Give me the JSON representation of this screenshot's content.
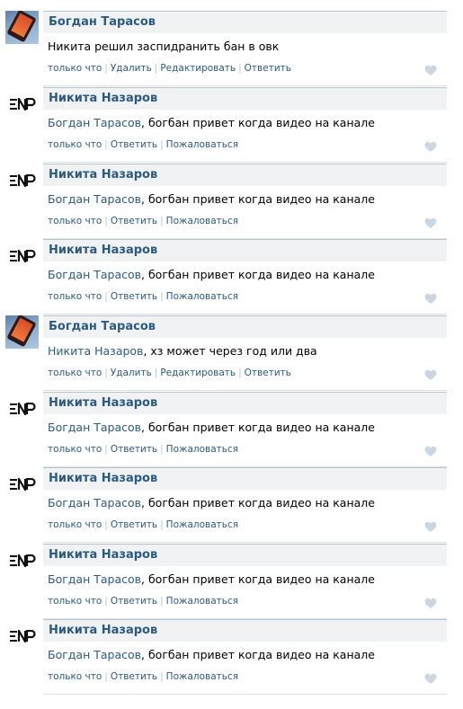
{
  "comments": [
    {
      "author": "Богдан Тарасов",
      "avatar": "photo",
      "mention": "",
      "text": "Никита решил заспидранить бан в овк",
      "actions": [
        "только что",
        "Удалить",
        "Редактировать",
        "Ответить"
      ]
    },
    {
      "author": "Никита Назаров",
      "avatar": "logo",
      "mention": "Богдан Тарасов",
      "text": ", богбан привет когда видео на канале",
      "actions": [
        "только что",
        "Ответить",
        "Пожаловаться"
      ]
    },
    {
      "author": "Никита Назаров",
      "avatar": "logo",
      "mention": "Богдан Тарасов",
      "text": ", богбан привет когда видео на канале",
      "actions": [
        "только что",
        "Ответить",
        "Пожаловаться"
      ]
    },
    {
      "author": "Никита Назаров",
      "avatar": "logo",
      "mention": "Богдан Тарасов",
      "text": ", богбан привет когда видео на канале",
      "actions": [
        "только что",
        "Ответить",
        "Пожаловаться"
      ]
    },
    {
      "author": "Богдан Тарасов",
      "avatar": "photo",
      "mention": "Никита Назаров",
      "text": ", хз может через год или два",
      "actions": [
        "только что",
        "Удалить",
        "Редактировать",
        "Ответить"
      ]
    },
    {
      "author": "Никита Назаров",
      "avatar": "logo",
      "mention": "Богдан Тарасов",
      "text": ", богбан привет когда видео на канале",
      "actions": [
        "только что",
        "Ответить",
        "Пожаловаться"
      ]
    },
    {
      "author": "Никита Назаров",
      "avatar": "logo",
      "mention": "Богдан Тарасов",
      "text": ", богбан привет когда видео на канале",
      "actions": [
        "только что",
        "Ответить",
        "Пожаловаться"
      ]
    },
    {
      "author": "Никита Назаров",
      "avatar": "logo",
      "mention": "Богдан Тарасов",
      "text": ", богбан привет когда видео на канале",
      "actions": [
        "только что",
        "Ответить",
        "Пожаловаться"
      ]
    },
    {
      "author": "Никита Назаров",
      "avatar": "logo",
      "mention": "Богдан Тарасов",
      "text": ", богбан привет когда видео на канале",
      "actions": [
        "только что",
        "Ответить",
        "Пожаловаться"
      ]
    }
  ],
  "colors": {
    "link": "#2b5a83",
    "header_bg": "#f0f2f4",
    "like": "#c9d6e3"
  }
}
